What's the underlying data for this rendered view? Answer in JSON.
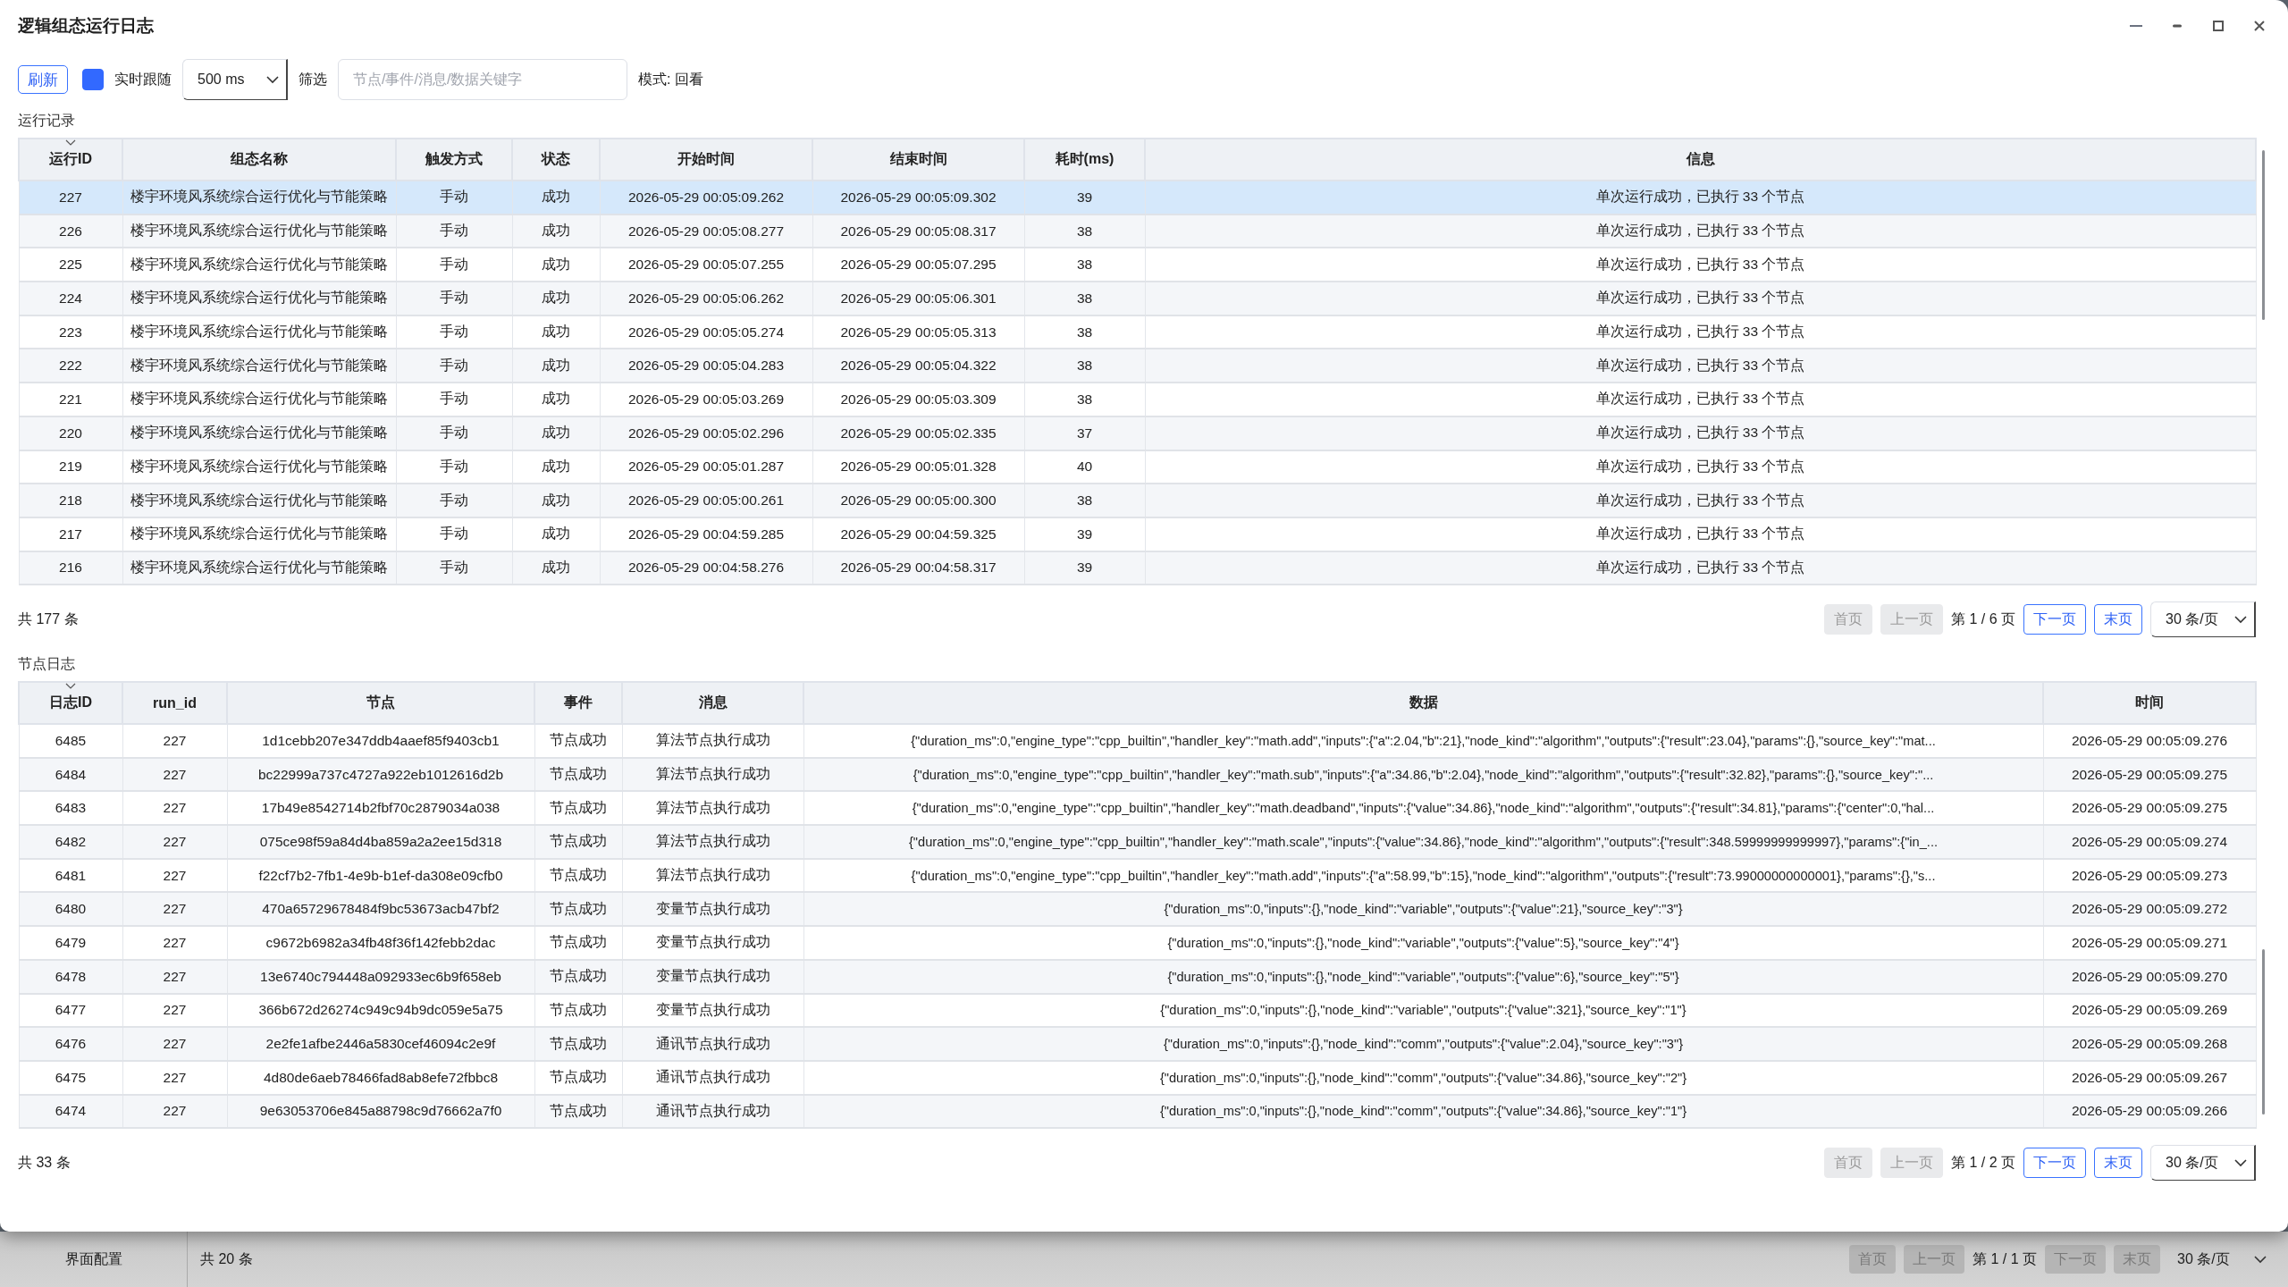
{
  "window": {
    "title": "逻辑组态运行日志"
  },
  "toolbar": {
    "refresh_button": "刷新",
    "follow": {
      "label": "实时跟随",
      "checked": true
    },
    "interval": "500 ms",
    "filter_label": "筛选",
    "filter": {
      "placeholder": "节点/事件/消息/数据关键字"
    },
    "mode": "模式: 回看"
  },
  "runs": {
    "title": "运行记录",
    "columns": [
      {
        "label": "运行ID",
        "sorted": true
      },
      {
        "label": "组态名称",
        "sorted": false
      },
      {
        "label": "触发方式",
        "sorted": false
      },
      {
        "label": "状态",
        "sorted": false
      },
      {
        "label": "开始时间",
        "sorted": false
      },
      {
        "label": "结束时间",
        "sorted": false
      },
      {
        "label": "耗时(ms)",
        "sorted": false
      },
      {
        "label": "信息",
        "sorted": false
      }
    ],
    "rows": [
      {
        "selected": true,
        "cells": [
          "227",
          "楼宇环境风系统综合运行优化与节能策略",
          "手动",
          "成功",
          "2026-05-29 00:05:09.262",
          "2026-05-29 00:05:09.302",
          "39",
          "单次运行成功，已执行 33 个节点"
        ]
      },
      {
        "selected": false,
        "cells": [
          "226",
          "楼宇环境风系统综合运行优化与节能策略",
          "手动",
          "成功",
          "2026-05-29 00:05:08.277",
          "2026-05-29 00:05:08.317",
          "38",
          "单次运行成功，已执行 33 个节点"
        ]
      },
      {
        "selected": false,
        "cells": [
          "225",
          "楼宇环境风系统综合运行优化与节能策略",
          "手动",
          "成功",
          "2026-05-29 00:05:07.255",
          "2026-05-29 00:05:07.295",
          "38",
          "单次运行成功，已执行 33 个节点"
        ]
      },
      {
        "selected": false,
        "cells": [
          "224",
          "楼宇环境风系统综合运行优化与节能策略",
          "手动",
          "成功",
          "2026-05-29 00:05:06.262",
          "2026-05-29 00:05:06.301",
          "38",
          "单次运行成功，已执行 33 个节点"
        ]
      },
      {
        "selected": false,
        "cells": [
          "223",
          "楼宇环境风系统综合运行优化与节能策略",
          "手动",
          "成功",
          "2026-05-29 00:05:05.274",
          "2026-05-29 00:05:05.313",
          "38",
          "单次运行成功，已执行 33 个节点"
        ]
      },
      {
        "selected": false,
        "cells": [
          "222",
          "楼宇环境风系统综合运行优化与节能策略",
          "手动",
          "成功",
          "2026-05-29 00:05:04.283",
          "2026-05-29 00:05:04.322",
          "38",
          "单次运行成功，已执行 33 个节点"
        ]
      },
      {
        "selected": false,
        "cells": [
          "221",
          "楼宇环境风系统综合运行优化与节能策略",
          "手动",
          "成功",
          "2026-05-29 00:05:03.269",
          "2026-05-29 00:05:03.309",
          "38",
          "单次运行成功，已执行 33 个节点"
        ]
      },
      {
        "selected": false,
        "cells": [
          "220",
          "楼宇环境风系统综合运行优化与节能策略",
          "手动",
          "成功",
          "2026-05-29 00:05:02.296",
          "2026-05-29 00:05:02.335",
          "37",
          "单次运行成功，已执行 33 个节点"
        ]
      },
      {
        "selected": false,
        "cells": [
          "219",
          "楼宇环境风系统综合运行优化与节能策略",
          "手动",
          "成功",
          "2026-05-29 00:05:01.287",
          "2026-05-29 00:05:01.328",
          "40",
          "单次运行成功，已执行 33 个节点"
        ]
      },
      {
        "selected": false,
        "cells": [
          "218",
          "楼宇环境风系统综合运行优化与节能策略",
          "手动",
          "成功",
          "2026-05-29 00:05:00.261",
          "2026-05-29 00:05:00.300",
          "38",
          "单次运行成功，已执行 33 个节点"
        ]
      },
      {
        "selected": false,
        "cells": [
          "217",
          "楼宇环境风系统综合运行优化与节能策略",
          "手动",
          "成功",
          "2026-05-29 00:04:59.285",
          "2026-05-29 00:04:59.325",
          "39",
          "单次运行成功，已执行 33 个节点"
        ]
      },
      {
        "selected": false,
        "cells": [
          "216",
          "楼宇环境风系统综合运行优化与节能策略",
          "手动",
          "成功",
          "2026-05-29 00:04:58.276",
          "2026-05-29 00:04:58.317",
          "39",
          "单次运行成功，已执行 33 个节点"
        ]
      }
    ],
    "total": "共 177 条",
    "pagination": {
      "buttons": [
        {
          "label": "首页",
          "disabled": true
        },
        {
          "label": "上一页",
          "disabled": true
        },
        {
          "label": "下一页",
          "disabled": false
        },
        {
          "label": "末页",
          "disabled": false
        }
      ],
      "page": "第 1 / 6 页",
      "page_size": "30 条/页"
    }
  },
  "node_logs": {
    "title": "节点日志",
    "columns": [
      {
        "label": "日志ID",
        "sorted": true
      },
      {
        "label": "run_id",
        "sorted": false
      },
      {
        "label": "节点",
        "sorted": false
      },
      {
        "label": "事件",
        "sorted": false
      },
      {
        "label": "消息",
        "sorted": false
      },
      {
        "label": "数据",
        "sorted": false
      },
      {
        "label": "时间",
        "sorted": false
      }
    ],
    "rows": [
      {
        "cells": [
          "6485",
          "227",
          "1d1cebb207e347ddb4aaef85f9403cb1",
          "节点成功",
          "算法节点执行成功",
          "{\"duration_ms\":0,\"engine_type\":\"cpp_builtin\",\"handler_key\":\"math.add\",\"inputs\":{\"a\":2.04,\"b\":21},\"node_kind\":\"algorithm\",\"outputs\":{\"result\":23.04},\"params\":{},\"source_key\":\"mat...",
          "2026-05-29 00:05:09.276"
        ]
      },
      {
        "cells": [
          "6484",
          "227",
          "bc22999a737c4727a922eb1012616d2b",
          "节点成功",
          "算法节点执行成功",
          "{\"duration_ms\":0,\"engine_type\":\"cpp_builtin\",\"handler_key\":\"math.sub\",\"inputs\":{\"a\":34.86,\"b\":2.04},\"node_kind\":\"algorithm\",\"outputs\":{\"result\":32.82},\"params\":{},\"source_key\":\"...",
          "2026-05-29 00:05:09.275"
        ]
      },
      {
        "cells": [
          "6483",
          "227",
          "17b49e8542714b2fbf70c2879034a038",
          "节点成功",
          "算法节点执行成功",
          "{\"duration_ms\":0,\"engine_type\":\"cpp_builtin\",\"handler_key\":\"math.deadband\",\"inputs\":{\"value\":34.86},\"node_kind\":\"algorithm\",\"outputs\":{\"result\":34.81},\"params\":{\"center\":0,\"hal...",
          "2026-05-29 00:05:09.275"
        ]
      },
      {
        "cells": [
          "6482",
          "227",
          "075ce98f59a84d4ba859a2a2ee15d318",
          "节点成功",
          "算法节点执行成功",
          "{\"duration_ms\":0,\"engine_type\":\"cpp_builtin\",\"handler_key\":\"math.scale\",\"inputs\":{\"value\":34.86},\"node_kind\":\"algorithm\",\"outputs\":{\"result\":348.59999999999997},\"params\":{\"in_...",
          "2026-05-29 00:05:09.274"
        ]
      },
      {
        "cells": [
          "6481",
          "227",
          "f22cf7b2-7fb1-4e9b-b1ef-da308e09cfb0",
          "节点成功",
          "算法节点执行成功",
          "{\"duration_ms\":0,\"engine_type\":\"cpp_builtin\",\"handler_key\":\"math.add\",\"inputs\":{\"a\":58.99,\"b\":15},\"node_kind\":\"algorithm\",\"outputs\":{\"result\":73.99000000000001},\"params\":{},\"s...",
          "2026-05-29 00:05:09.273"
        ]
      },
      {
        "cells": [
          "6480",
          "227",
          "470a65729678484f9bc53673acb47bf2",
          "节点成功",
          "变量节点执行成功",
          "{\"duration_ms\":0,\"inputs\":{},\"node_kind\":\"variable\",\"outputs\":{\"value\":21},\"source_key\":\"3\"}",
          "2026-05-29 00:05:09.272"
        ]
      },
      {
        "cells": [
          "6479",
          "227",
          "c9672b6982a34fb48f36f142febb2dac",
          "节点成功",
          "变量节点执行成功",
          "{\"duration_ms\":0,\"inputs\":{},\"node_kind\":\"variable\",\"outputs\":{\"value\":5},\"source_key\":\"4\"}",
          "2026-05-29 00:05:09.271"
        ]
      },
      {
        "cells": [
          "6478",
          "227",
          "13e6740c794448a092933ec6b9f658eb",
          "节点成功",
          "变量节点执行成功",
          "{\"duration_ms\":0,\"inputs\":{},\"node_kind\":\"variable\",\"outputs\":{\"value\":6},\"source_key\":\"5\"}",
          "2026-05-29 00:05:09.270"
        ]
      },
      {
        "cells": [
          "6477",
          "227",
          "366b672d26274c949c94b9dc059e5a75",
          "节点成功",
          "变量节点执行成功",
          "{\"duration_ms\":0,\"inputs\":{},\"node_kind\":\"variable\",\"outputs\":{\"value\":321},\"source_key\":\"1\"}",
          "2026-05-29 00:05:09.269"
        ]
      },
      {
        "cells": [
          "6476",
          "227",
          "2e2fe1afbe2446a5830cef46094c2e9f",
          "节点成功",
          "通讯节点执行成功",
          "{\"duration_ms\":0,\"inputs\":{},\"node_kind\":\"comm\",\"outputs\":{\"value\":2.04},\"source_key\":\"3\"}",
          "2026-05-29 00:05:09.268"
        ]
      },
      {
        "cells": [
          "6475",
          "227",
          "4d80de6aeb78466fad8ab8efe72fbbc8",
          "节点成功",
          "通讯节点执行成功",
          "{\"duration_ms\":0,\"inputs\":{},\"node_kind\":\"comm\",\"outputs\":{\"value\":34.86},\"source_key\":\"2\"}",
          "2026-05-29 00:05:09.267"
        ]
      },
      {
        "cells": [
          "6474",
          "227",
          "9e63053706e845a88798c9d76662a7f0",
          "节点成功",
          "通讯节点执行成功",
          "{\"duration_ms\":0,\"inputs\":{},\"node_kind\":\"comm\",\"outputs\":{\"value\":34.86},\"source_key\":\"1\"}",
          "2026-05-29 00:05:09.266"
        ]
      }
    ],
    "total": "共 33 条",
    "pagination": {
      "buttons": [
        {
          "label": "首页",
          "disabled": true
        },
        {
          "label": "上一页",
          "disabled": true
        },
        {
          "label": "下一页",
          "disabled": false
        },
        {
          "label": "末页",
          "disabled": false
        }
      ],
      "page": "第 1 / 2 页",
      "page_size": "30 条/页"
    }
  },
  "background_app": {
    "sidebar_item": "界面配置",
    "total": "共 20 条",
    "pagination": {
      "buttons": [
        {
          "label": "首页",
          "disabled": true
        },
        {
          "label": "上一页",
          "disabled": true
        },
        {
          "label": "下一页",
          "disabled": true
        },
        {
          "label": "末页",
          "disabled": true
        }
      ],
      "page": "第 1 / 1 页",
      "page_size": "30 条/页"
    }
  }
}
